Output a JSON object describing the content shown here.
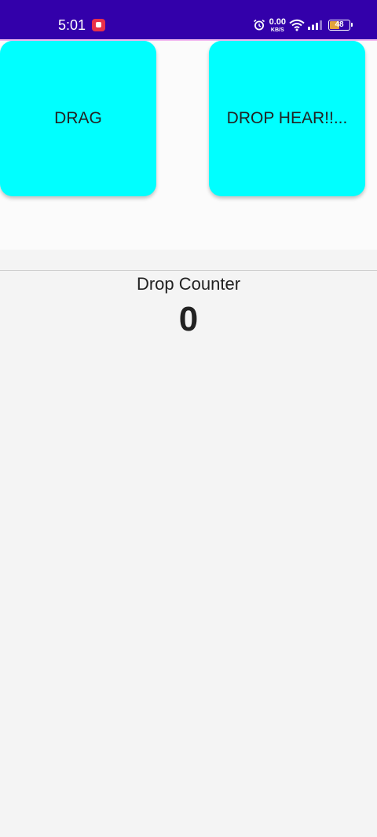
{
  "status_bar": {
    "time": "5:01",
    "network_speed": "0.00",
    "network_speed_unit": "KB/S",
    "battery_level": "48",
    "battery_fraction": 0.48,
    "icons": [
      "screen-record-icon",
      "alarm-icon",
      "wifi-icon",
      "signal-icon",
      "battery-icon"
    ],
    "colors": {
      "bar": "#3300aa",
      "battery_fill": "#e3a33c"
    }
  },
  "drag_box": {
    "label": "DRAG",
    "color": "#00ffff"
  },
  "drop_box": {
    "label": "DROP HEAR!!..."
  },
  "counter": {
    "label": "Drop Counter",
    "value": "0"
  }
}
